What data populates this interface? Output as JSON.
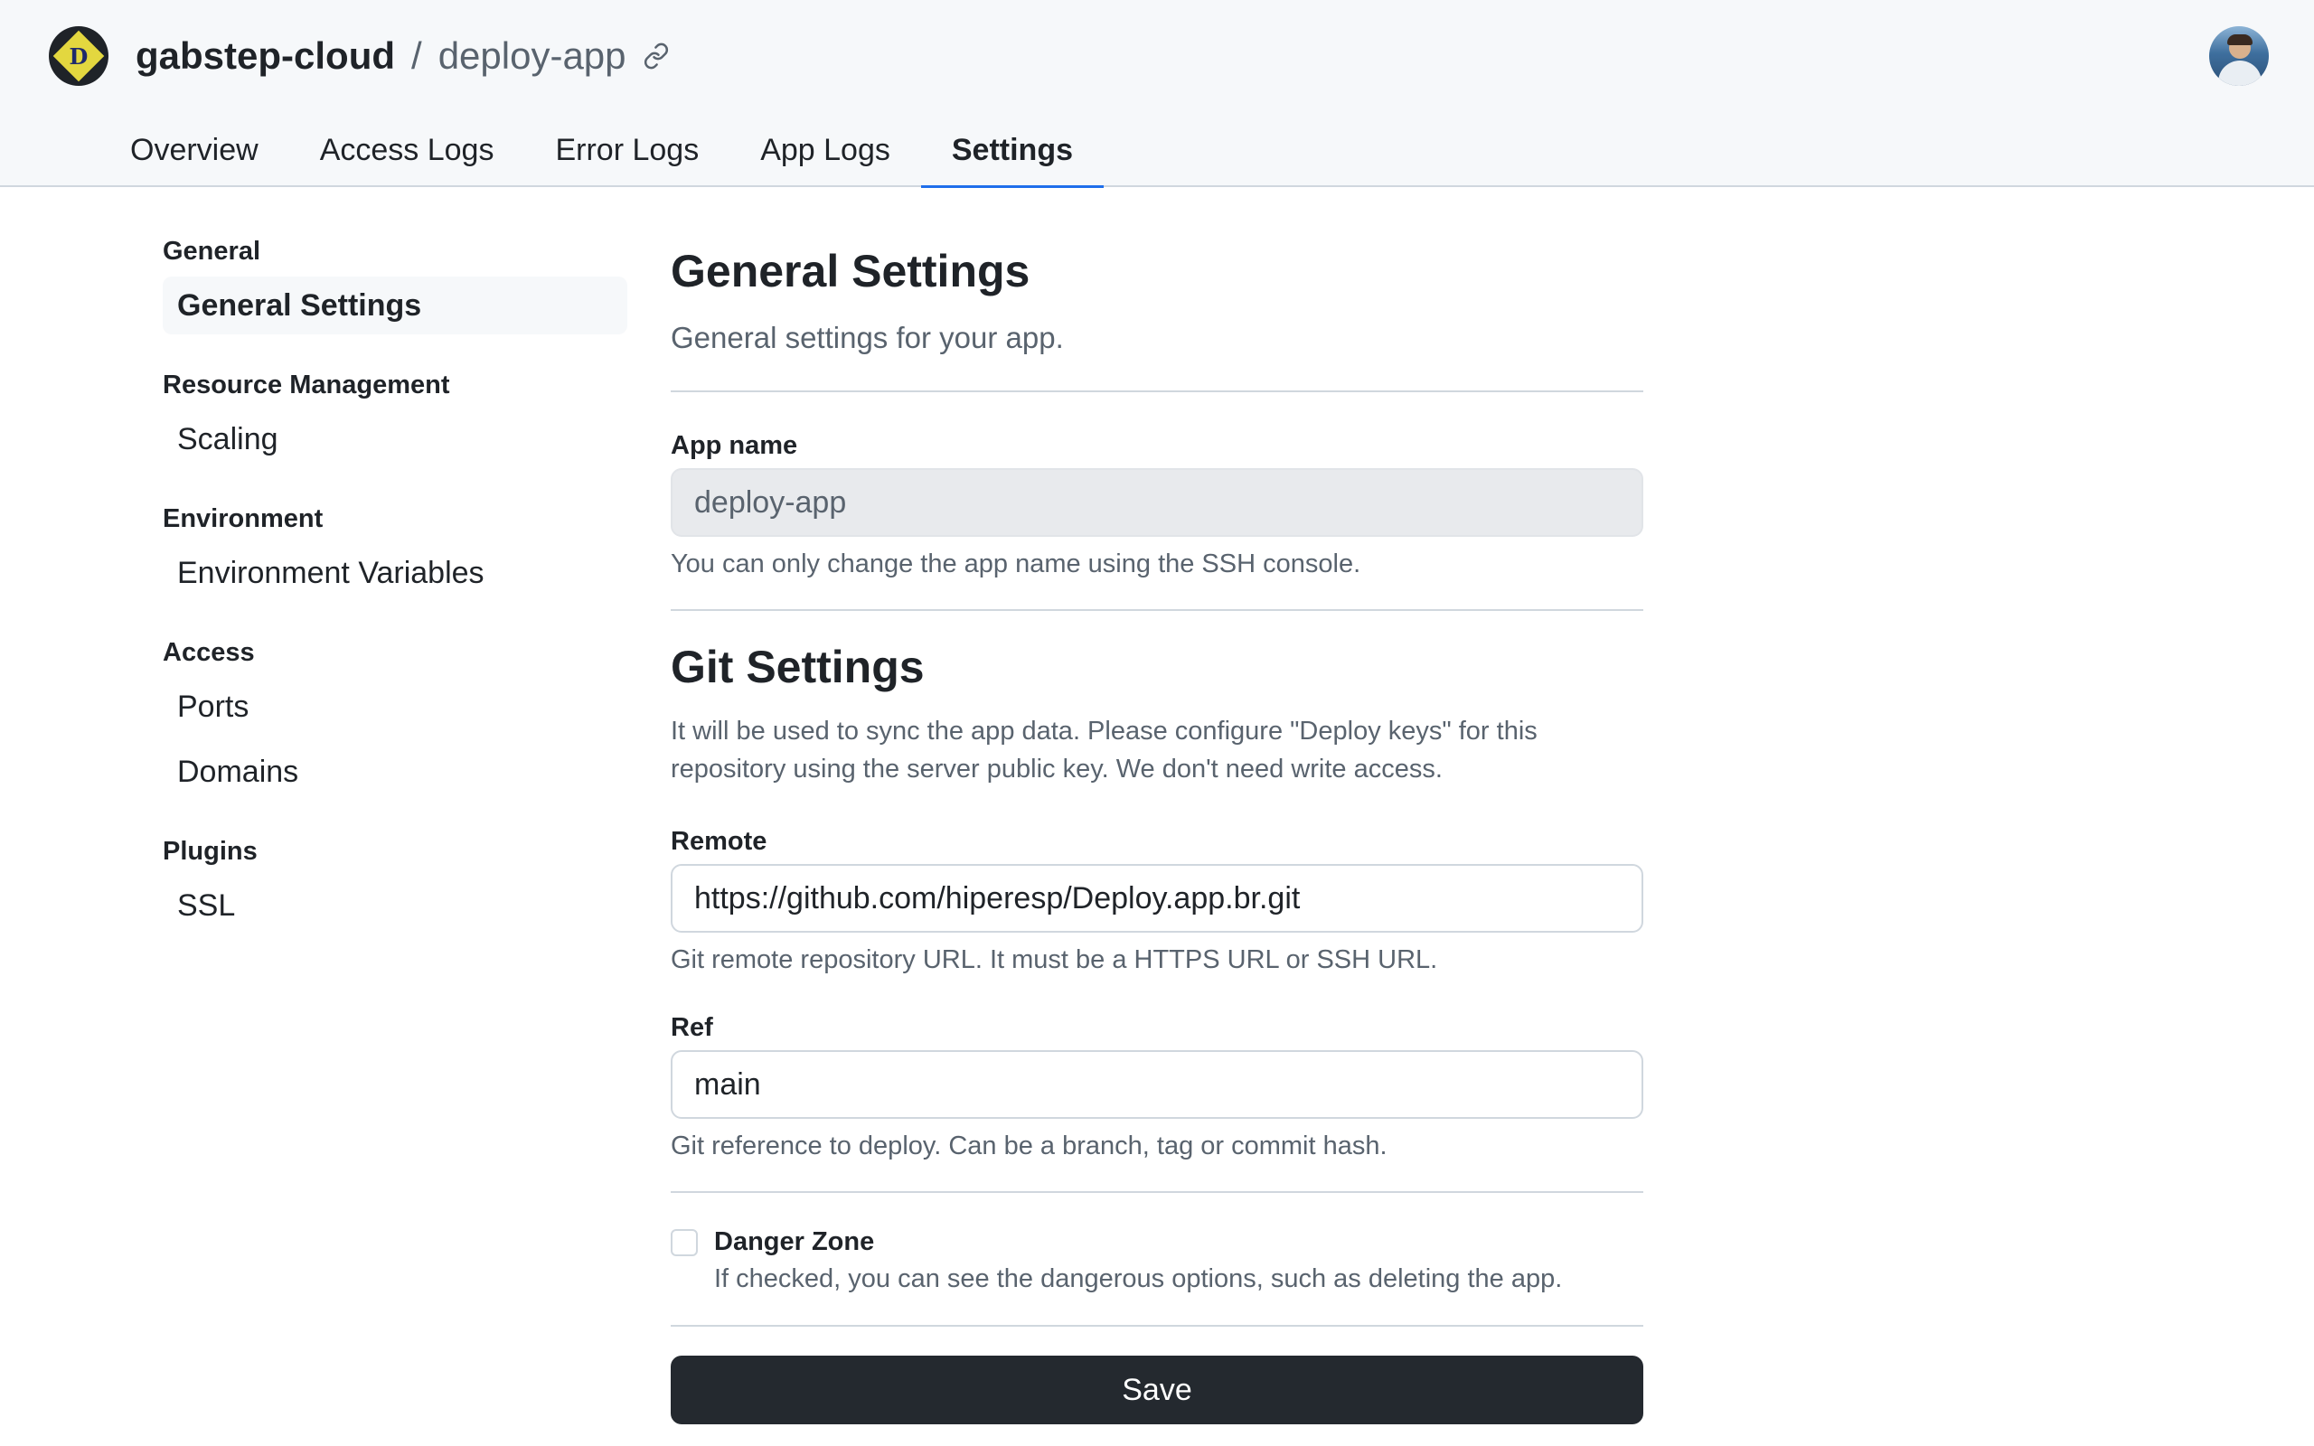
{
  "header": {
    "owner": "gabstep-cloud",
    "separator": "/",
    "app_name": "deploy-app",
    "logo_icon": "logo-d-icon",
    "link_icon": "link-icon"
  },
  "tabs": [
    {
      "label": "Overview",
      "active": false
    },
    {
      "label": "Access Logs",
      "active": false
    },
    {
      "label": "Error Logs",
      "active": false
    },
    {
      "label": "App Logs",
      "active": false
    },
    {
      "label": "Settings",
      "active": true
    }
  ],
  "sidebar": {
    "groups": [
      {
        "title": "General",
        "items": [
          {
            "label": "General Settings",
            "active": true
          }
        ]
      },
      {
        "title": "Resource Management",
        "items": [
          {
            "label": "Scaling",
            "active": false
          }
        ]
      },
      {
        "title": "Environment",
        "items": [
          {
            "label": "Environment Variables",
            "active": false
          }
        ]
      },
      {
        "title": "Access",
        "items": [
          {
            "label": "Ports",
            "active": false
          },
          {
            "label": "Domains",
            "active": false
          }
        ]
      },
      {
        "title": "Plugins",
        "items": [
          {
            "label": "SSL",
            "active": false
          }
        ]
      }
    ]
  },
  "general": {
    "title": "General Settings",
    "subtitle": "General settings for your app.",
    "app_name_label": "App name",
    "app_name_value": "deploy-app",
    "app_name_help": "You can only change the app name using the SSH console."
  },
  "git": {
    "title": "Git Settings",
    "description": "It will be used to sync the app data. Please configure \"Deploy keys\" for this repository using the server public key. We don't need write access.",
    "remote_label": "Remote",
    "remote_value": "https://github.com/hiperesp/Deploy.app.br.git",
    "remote_help": "Git remote repository URL. It must be a HTTPS URL or SSH URL.",
    "ref_label": "Ref",
    "ref_value": "main",
    "ref_help": "Git reference to deploy. Can be a branch, tag or commit hash."
  },
  "danger": {
    "label": "Danger Zone",
    "help": "If checked, you can see the dangerous options, such as deleting the app.",
    "checked": false
  },
  "save_label": "Save",
  "colors": {
    "header_bg": "#f6f8fa",
    "active_tab_underline": "#1f6feb",
    "save_button_bg": "#24292f"
  }
}
